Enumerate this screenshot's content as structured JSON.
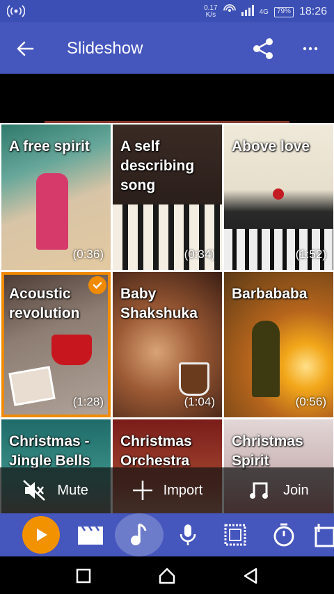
{
  "status": {
    "speed_value": "0.17",
    "speed_unit": "K/s",
    "network": "4G",
    "battery": "79%",
    "time": "18:26"
  },
  "app_bar": {
    "title": "Slideshow"
  },
  "tiles": [
    {
      "label": "A free spirit",
      "duration": "(0:36)"
    },
    {
      "label": "A self describing song",
      "duration": "(0:34)"
    },
    {
      "label": "Above love",
      "duration": "(1:52)"
    },
    {
      "label": "Acoustic revolution",
      "duration": "(1:28)"
    },
    {
      "label": "Baby Shakshuka",
      "duration": "(1:04)"
    },
    {
      "label": "Barbababa",
      "duration": "(0:56)"
    },
    {
      "label": "Christmas - Jingle Bells",
      "duration": ""
    },
    {
      "label": "Christmas Orchestra",
      "duration": ""
    },
    {
      "label": "Christmas Spirit",
      "duration": ""
    }
  ],
  "actions": {
    "mute": "Mute",
    "import": "Import",
    "join": "Join"
  },
  "toolbar_icons": [
    "play-icon",
    "clapperboard-icon",
    "music-note-icon",
    "microphone-icon",
    "frame-icon",
    "timer-icon",
    "add-text-icon"
  ],
  "colors": {
    "primary": "#4556bd",
    "accent": "#f39200",
    "status_bar": "#3b4fb5"
  }
}
